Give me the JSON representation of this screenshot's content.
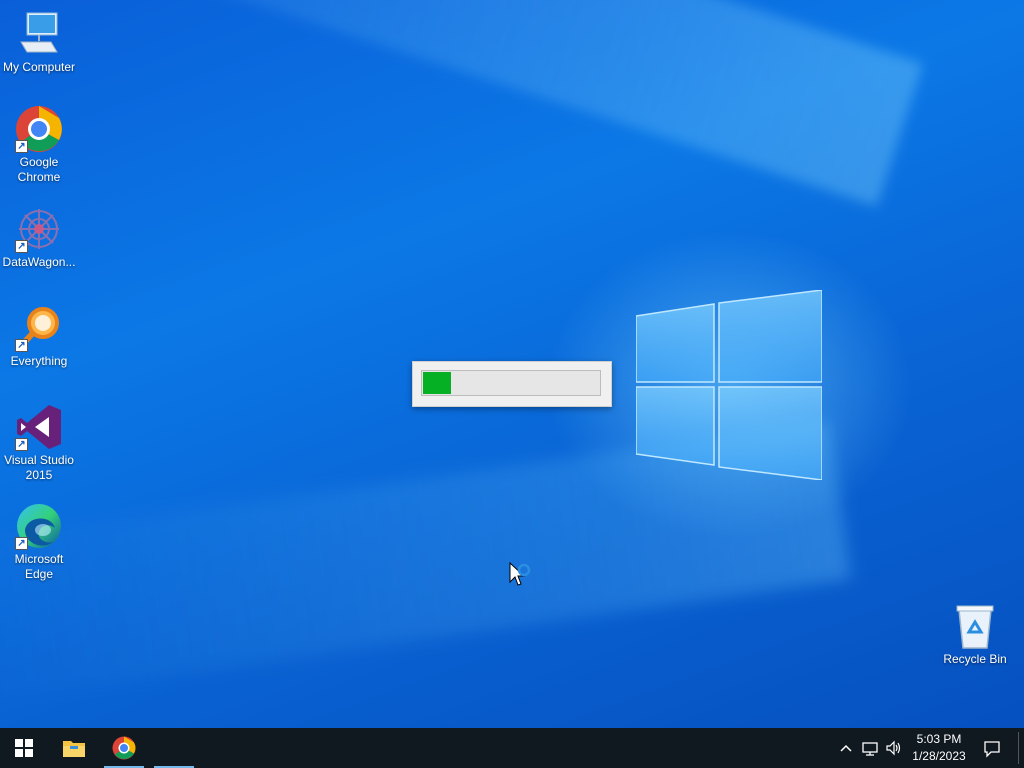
{
  "desktop": {
    "icons": [
      {
        "label": "My Computer",
        "icon": "computer-icon"
      },
      {
        "label": "Google Chrome",
        "icon": "chrome-icon"
      },
      {
        "label": "DataWagon...",
        "icon": "datawagon-icon"
      },
      {
        "label": "Everything",
        "icon": "everything-search-icon"
      },
      {
        "label": "Visual Studio 2015",
        "icon": "visual-studio-icon"
      },
      {
        "label": "Microsoft Edge",
        "icon": "edge-icon"
      },
      {
        "label": "Recycle Bin",
        "icon": "recycle-bin-icon"
      }
    ]
  },
  "progress_dialog": {
    "progress_fraction": 0.16,
    "fill_color": "#06b025"
  },
  "taskbar": {
    "start_icon": "windows-start-icon",
    "pinned": [
      {
        "name": "File Explorer",
        "icon": "folder-icon"
      },
      {
        "name": "Google Chrome",
        "icon": "chrome-icon",
        "active": true
      }
    ],
    "tray": {
      "icons": [
        "chevron-up-icon",
        "network-icon",
        "volume-icon"
      ],
      "time": "5:03 PM",
      "date": "1/28/2023"
    }
  },
  "colors": {
    "accent": "#76b9ed",
    "taskbar": "#101820",
    "desktop_blue": "#0b78e6"
  }
}
